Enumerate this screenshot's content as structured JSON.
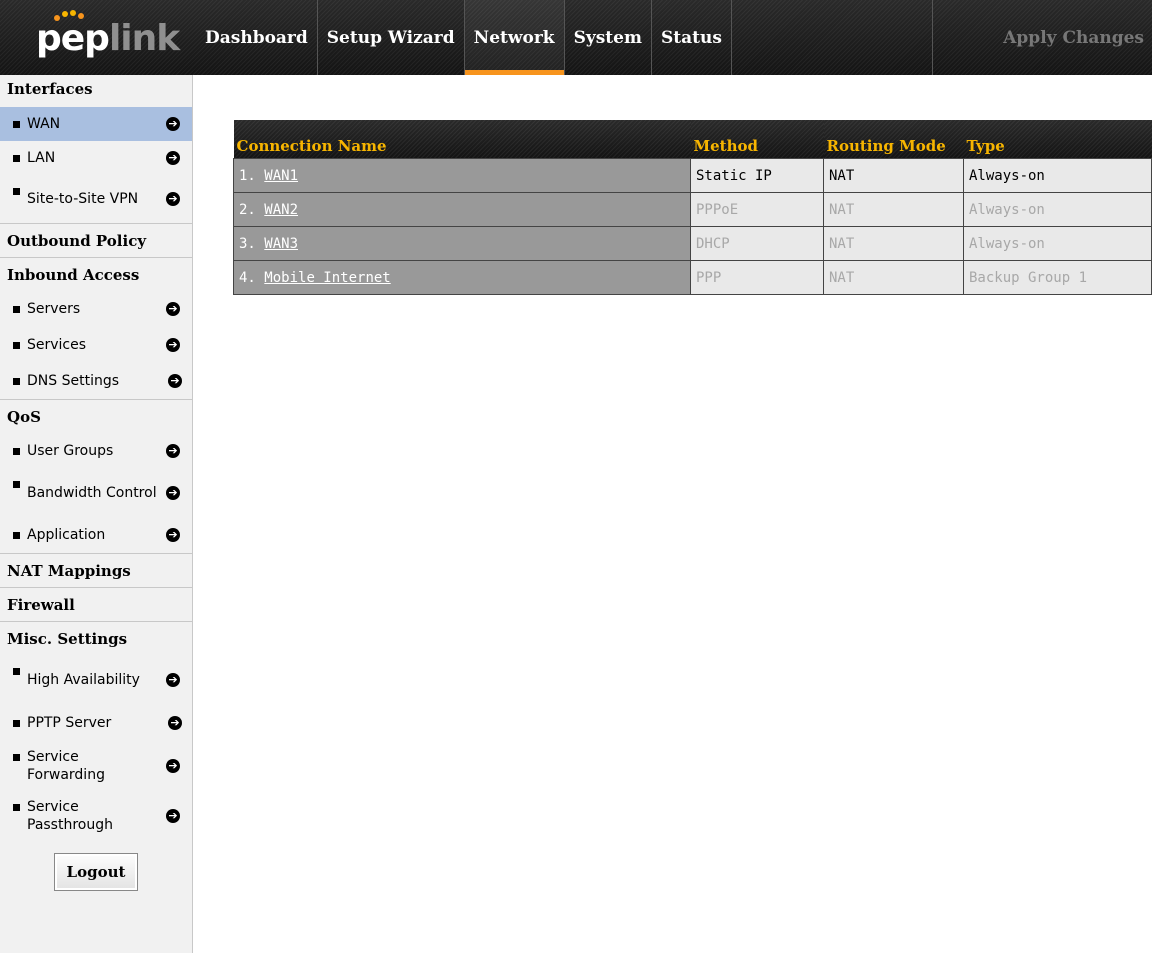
{
  "logo": {
    "pep": "pep",
    "link": "link"
  },
  "nav": {
    "items": [
      "Dashboard",
      "Setup Wizard",
      "Network",
      "System",
      "Status"
    ],
    "active": "Network",
    "apply": "Apply Changes"
  },
  "sidebar": {
    "interfaces": "Interfaces",
    "interfaces_items": [
      "WAN",
      "LAN",
      "Site-to-Site VPN"
    ],
    "outbound": "Outbound Policy",
    "inbound": "Inbound Access",
    "inbound_items": [
      "Servers",
      "Services",
      "DNS Settings"
    ],
    "qos": "QoS",
    "qos_items": [
      "User Groups",
      "Bandwidth Control",
      "Application"
    ],
    "nat": "NAT Mappings",
    "firewall": "Firewall",
    "misc": "Misc. Settings",
    "misc_items": [
      "High Availability",
      "PPTP Server",
      "Service Forwarding",
      "Service Passthrough"
    ],
    "logout": "Logout"
  },
  "table": {
    "headers": [
      "Connection Name",
      "Method",
      "Routing Mode",
      "Type"
    ],
    "rows": [
      {
        "num": "1.",
        "name": "WAN1",
        "method": "Static IP",
        "routing": "NAT",
        "type": "Always-on"
      },
      {
        "num": "2.",
        "name": "WAN2",
        "method": "PPPoE",
        "routing": "NAT",
        "type": "Always-on"
      },
      {
        "num": "3.",
        "name": "WAN3",
        "method": "DHCP",
        "routing": "NAT",
        "type": "Always-on"
      },
      {
        "num": "4.",
        "name": "Mobile Internet",
        "method": "PPP",
        "routing": "NAT",
        "type": "Backup Group 1"
      }
    ]
  },
  "colors": {
    "accent": "#f7941d",
    "header_text": "#f7b500",
    "active_row": "#a9bfe0"
  }
}
